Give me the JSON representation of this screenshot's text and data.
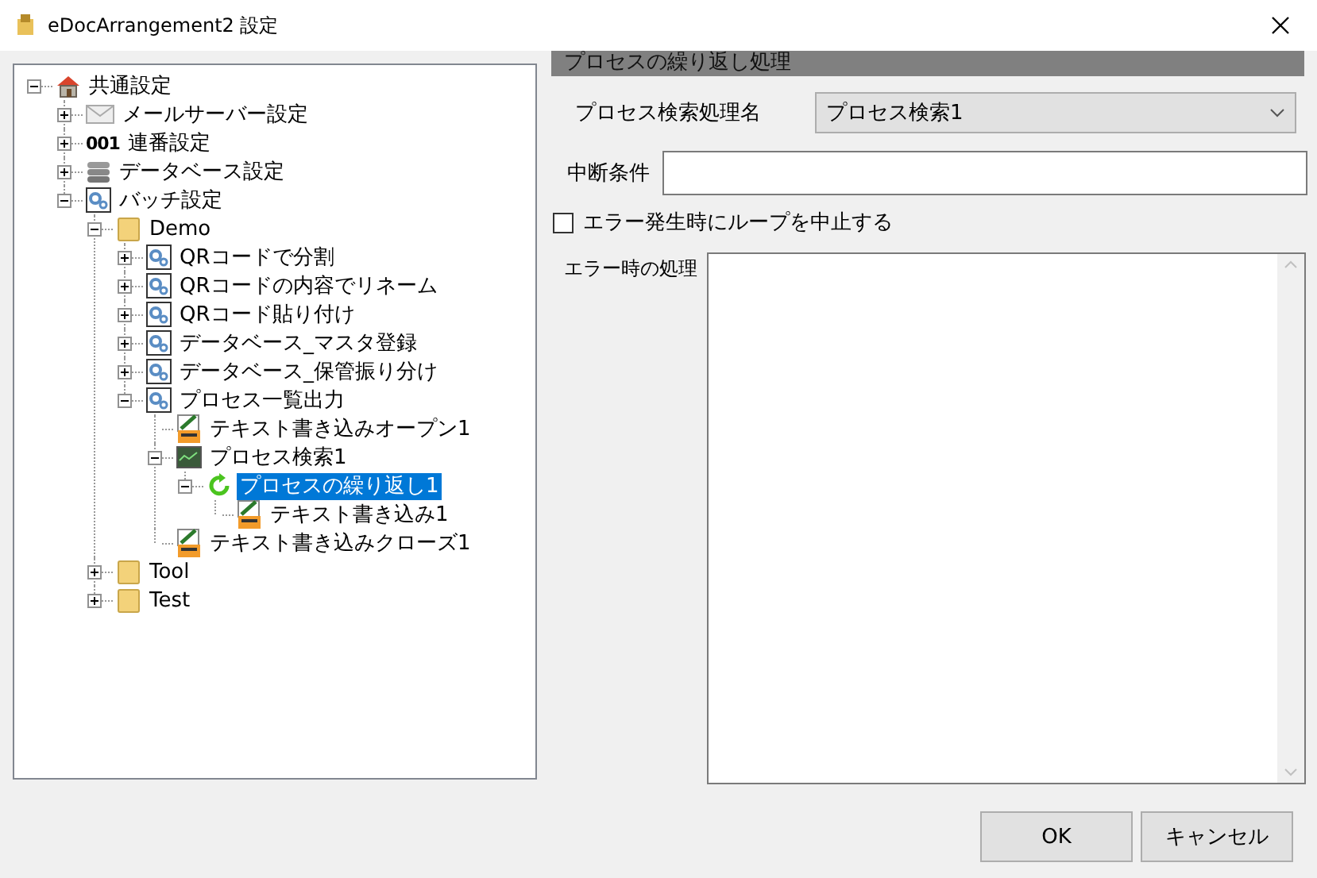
{
  "window": {
    "title": "eDocArrangement2 設定"
  },
  "tree": [
    {
      "label": "共通設定",
      "kind": "home",
      "expanded": true,
      "selected": false,
      "children": [
        {
          "label": "メールサーバー設定",
          "kind": "mail",
          "expanded": false,
          "selected": false
        },
        {
          "label": "連番設定",
          "kind": "counter",
          "icon_text": "001",
          "expanded": false,
          "selected": false
        },
        {
          "label": "データベース設定",
          "kind": "database",
          "expanded": false,
          "selected": false
        },
        {
          "label": "バッチ設定",
          "kind": "gear",
          "expanded": true,
          "selected": false,
          "children": [
            {
              "label": "Demo",
              "kind": "folder",
              "expanded": true,
              "selected": false,
              "children": [
                {
                  "label": "QRコードで分割",
                  "kind": "gear",
                  "expanded": false,
                  "selected": false
                },
                {
                  "label": "QRコードの内容でリネーム",
                  "kind": "gear",
                  "expanded": false,
                  "selected": false
                },
                {
                  "label": "QRコード貼り付け",
                  "kind": "gear",
                  "expanded": false,
                  "selected": false
                },
                {
                  "label": "データベース_マスタ登録",
                  "kind": "gear",
                  "expanded": false,
                  "selected": false
                },
                {
                  "label": "データベース_保管振り分け",
                  "kind": "gear",
                  "expanded": false,
                  "selected": false
                },
                {
                  "label": "プロセス一覧出力",
                  "kind": "gear",
                  "expanded": true,
                  "selected": false,
                  "children": [
                    {
                      "label": "テキスト書き込みオープン1",
                      "kind": "textfile",
                      "selected": false
                    },
                    {
                      "label": "プロセス検索1",
                      "kind": "monitor",
                      "expanded": true,
                      "selected": false,
                      "children": [
                        {
                          "label": "プロセスの繰り返し1",
                          "kind": "loop",
                          "expanded": true,
                          "selected": true,
                          "children": [
                            {
                              "label": "テキスト書き込み1",
                              "kind": "textfile",
                              "selected": false
                            }
                          ]
                        }
                      ]
                    },
                    {
                      "label": "テキスト書き込みクローズ1",
                      "kind": "textfile",
                      "selected": false
                    }
                  ]
                }
              ]
            },
            {
              "label": "Tool",
              "kind": "folder",
              "expanded": false,
              "selected": false
            },
            {
              "label": "Test",
              "kind": "folder",
              "expanded": false,
              "selected": false
            }
          ]
        }
      ]
    }
  ],
  "panel": {
    "title": "プロセスの繰り返し処理",
    "fields": [
      {
        "kind": "select",
        "label": "プロセス検索処理名",
        "value": "プロセス検索1"
      },
      {
        "kind": "text",
        "label": "中断条件"
      },
      {
        "kind": "checkbox",
        "label": "エラー発生時にループを中止する",
        "checked": false
      },
      {
        "kind": "textarea",
        "label": "エラー時の処理"
      }
    ]
  },
  "buttons": [
    {
      "label": "OK"
    },
    {
      "label": "キャンセル"
    }
  ]
}
